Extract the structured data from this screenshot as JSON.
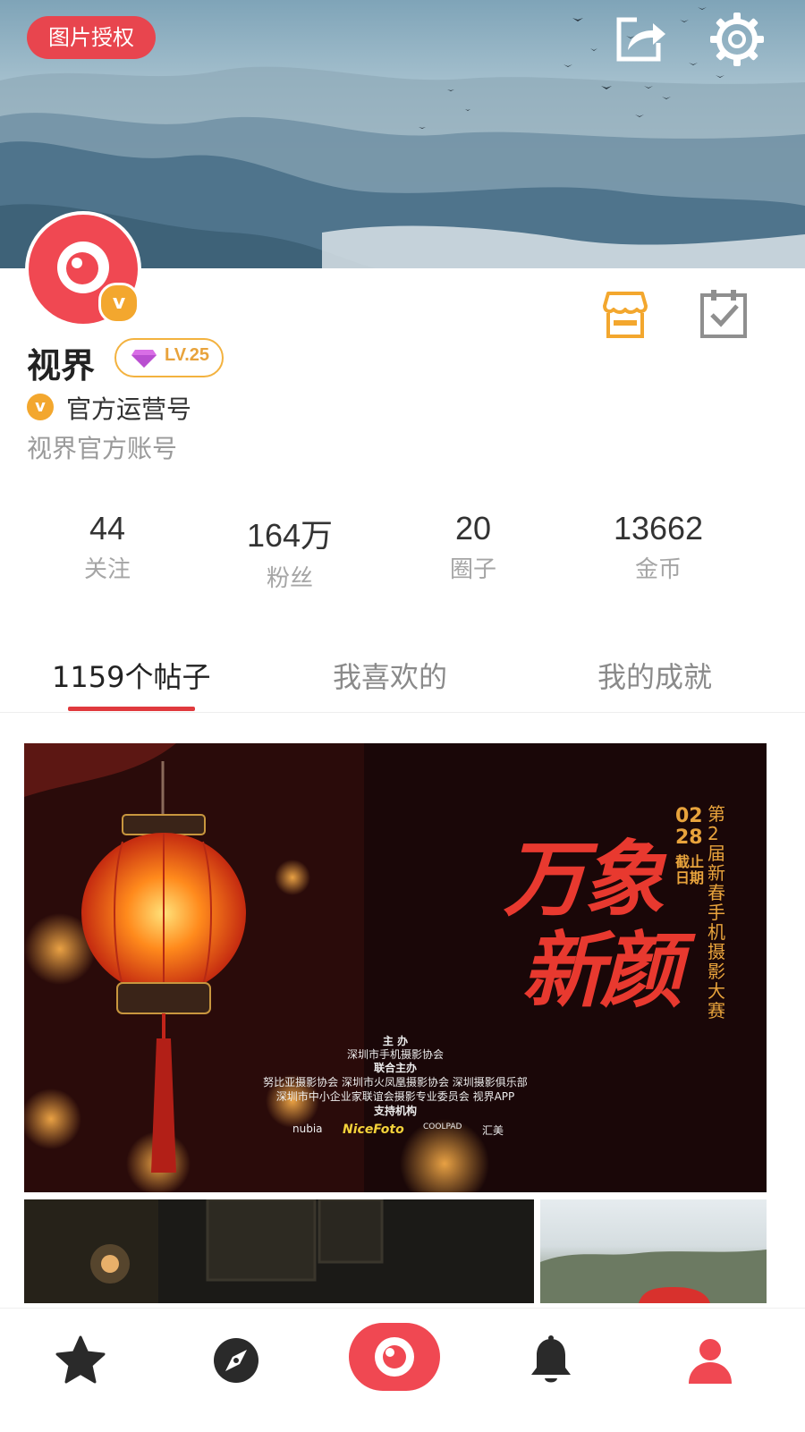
{
  "header": {
    "auth_badge": "图片授权"
  },
  "profile": {
    "username": "视界",
    "level": "LV.25",
    "official_tag": "官方运营号",
    "bio": "视界官方账号",
    "verify_mark": "v"
  },
  "stats": [
    {
      "value": "44",
      "label": "关注"
    },
    {
      "value": "164万",
      "label": "粉丝"
    },
    {
      "value": "20",
      "label": "圈子"
    },
    {
      "value": "13662",
      "label": "金币"
    }
  ],
  "tabs": [
    {
      "label": "1159个帖子",
      "active": true
    },
    {
      "label": "我喜欢的",
      "active": false
    },
    {
      "label": "我的成就",
      "active": false
    }
  ],
  "feed": {
    "poster": {
      "title_line1": "万象",
      "title_line2": "新颜",
      "date": "02 28",
      "deadline": "截止日期",
      "vertical_title": "第2届新春手机摄影大赛",
      "host_label": "主 办",
      "host": "深圳市手机摄影协会",
      "co_host_label": "联合主办",
      "co_hosts_1": "努比亚摄影协会 深圳市火凤凰摄影协会 深圳摄影俱乐部",
      "co_hosts_2": "深圳市中小企业家联谊会摄影专业委员会 视界APP",
      "support_label": "支持机构",
      "sponsors": [
        "nubia",
        "NiceFoto",
        "COOLPAD",
        "汇美"
      ]
    }
  },
  "colors": {
    "accent_red": "#f04852",
    "tab_underline": "#e03a3e",
    "gold": "#f3a72e"
  },
  "icons": {
    "share": "share-icon",
    "settings": "gear-icon",
    "store": "store-icon",
    "checkin": "clipboard-check-icon",
    "nav": [
      "star-icon",
      "compass-icon",
      "camera-eye-icon",
      "bell-icon",
      "user-icon"
    ]
  }
}
